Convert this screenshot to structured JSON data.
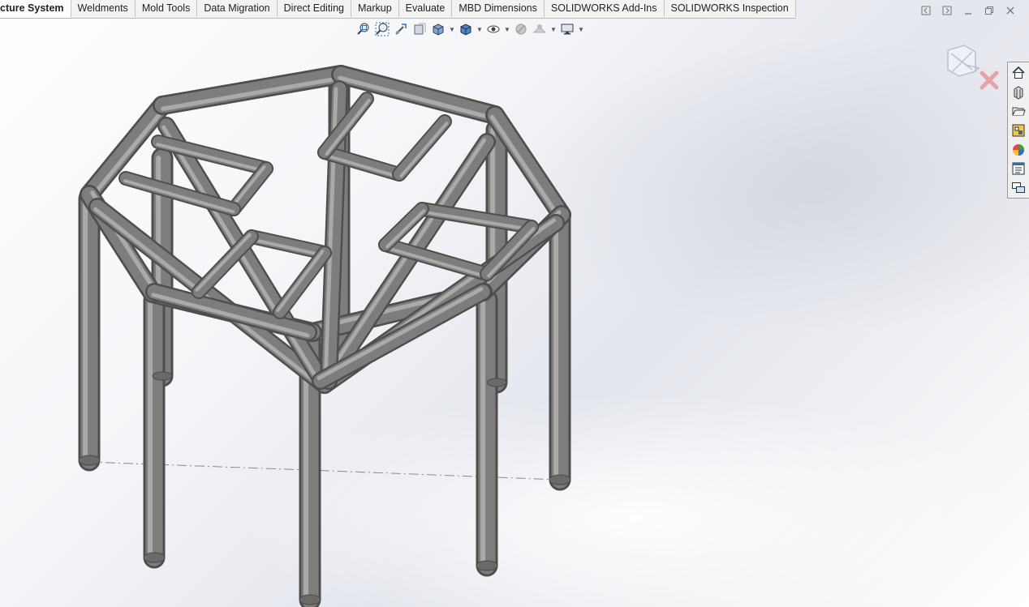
{
  "tabs": [
    {
      "label": "cture System",
      "active": true
    },
    {
      "label": "Weldments"
    },
    {
      "label": "Mold Tools"
    },
    {
      "label": "Data Migration"
    },
    {
      "label": "Direct Editing"
    },
    {
      "label": "Markup"
    },
    {
      "label": "Evaluate"
    },
    {
      "label": "MBD Dimensions"
    },
    {
      "label": "SOLIDWORKS Add-Ins"
    },
    {
      "label": "SOLIDWORKS Inspection"
    }
  ],
  "window_controls": [
    "float-left-icon",
    "float-right-icon",
    "minimize-icon",
    "restore-icon",
    "close-icon"
  ],
  "heads_up_toolbar": [
    "zoom-to-fit-icon",
    "zoom-to-area-icon",
    "previous-view-icon",
    "section-view-icon",
    "view-orientation-icon",
    "display-style-icon",
    "hide-show-items-icon",
    "edit-appearance-icon",
    "apply-scene-icon",
    "view-settings-icon"
  ],
  "task_pane": [
    "solidworks-resources-icon",
    "design-library-icon",
    "file-explorer-icon",
    "view-palette-icon",
    "appearances-scenes-icon",
    "custom-properties-icon",
    "forum-icon"
  ],
  "colors": {
    "tube": "#7d7d7d",
    "tube_highlight": "#b9b9b9",
    "tube_shadow": "#4e4e4e",
    "active_tab_bg": "#ffffff",
    "confirm_cancel": "#e06060"
  }
}
